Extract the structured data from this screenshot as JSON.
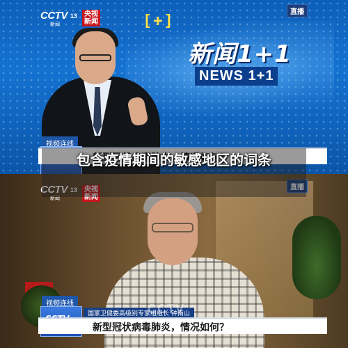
{
  "top_frame": {
    "logo_text": "CCTV",
    "logo_num": "13",
    "logo_sub": "新闻",
    "channel_box": "央视\n新闻",
    "live_label": "直播",
    "bracket": "[+]",
    "show_title": "新闻1+1",
    "show_subtitle": "NEWS 1+1",
    "tag_video": "视频连线",
    "lower_third": "新型冠状病毒肺炎，情况如何？"
  },
  "bottom_frame": {
    "logo_text": "CCTV",
    "logo_num": "13",
    "logo_sub": "新闻",
    "channel_box": "央视\n新闻",
    "live_label": "直播",
    "tag_video": "视频连线",
    "tag_cctv": "CCTV",
    "tag_cctv_sub": "新闻",
    "name_strip": "国家卫健委高级别专家组组长 钟南山",
    "lower_third": "新型冠状病毒肺炎，情况如何？",
    "watermark": "CCTV"
  },
  "caption": "包含疫情期间的敏感地区的词条",
  "colors": {
    "studio_blue": "#1572d1",
    "cctv_red": "#c8161d",
    "accent_yellow": "#ffe14a",
    "banner_blue": "#173f86"
  }
}
